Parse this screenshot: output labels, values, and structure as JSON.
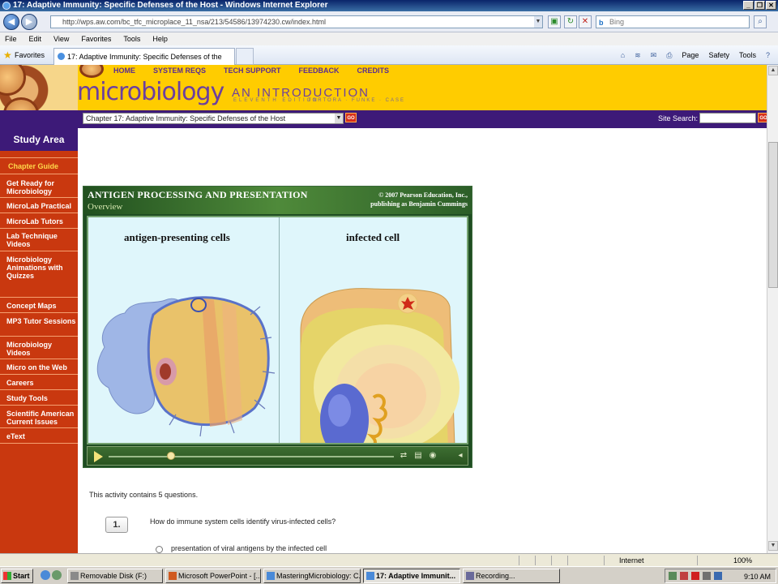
{
  "window": {
    "title": "17: Adaptive Immunity: Specific Defenses of the Host - Windows Internet Explorer"
  },
  "addressbar": {
    "url": "http://wps.aw.com/bc_tfc_microplace_11_nsa/213/54586/13974230.cw/index.html",
    "search_placeholder": "Bing"
  },
  "menubar": [
    "File",
    "Edit",
    "View",
    "Favorites",
    "Tools",
    "Help"
  ],
  "favorites": {
    "label": "Favorites",
    "tab_title": "17: Adaptive Immunity: Specific Defenses of the Host"
  },
  "command_bar": {
    "page": "Page",
    "safety": "Safety",
    "tools": "Tools"
  },
  "site": {
    "nav": [
      "HOME",
      "SYSTEM REQS",
      "TECH SUPPORT",
      "FEEDBACK",
      "CREDITS"
    ],
    "logo_main": "microbiology",
    "logo_sub": "AN INTRODUCTION",
    "logo_edition": "ELEVENTH EDITION",
    "logo_authors": "TORTORA · FUNKE · CASE",
    "chapter_select": "Chapter 17: Adaptive Immunity: Specific Defenses of the Host",
    "go_label": "GO",
    "site_search_label": "Site Search:"
  },
  "sidebar": {
    "title": "Study Area",
    "chapter_guide": "Chapter Guide",
    "items": [
      "Get Ready for Microbiology",
      "MicroLab Practical",
      "MicroLab Tutors",
      "Lab Technique Videos",
      "Microbiology Animations with Quizzes",
      "Concept Maps",
      "MP3 Tutor Sessions",
      "Microbiology Videos",
      "Micro on the Web",
      "Careers",
      "Study Tools",
      "Scientific American Current Issues",
      "eText"
    ]
  },
  "animation": {
    "title": "ANTIGEN PROCESSING AND PRESENTATION",
    "subtitle": "Overview",
    "copyright_1": "© 2007 Pearson Education, Inc.,",
    "copyright_2": "publishing as Benjamin Cummings",
    "left_label": "antigen-presenting cells",
    "right_label": "infected cell",
    "progress": 0.22
  },
  "quiz": {
    "intro": "This activity contains 5 questions.",
    "number": "1.",
    "question": "How do immune system cells identify virus-infected cells?",
    "option_1": "presentation of viral antigens by the infected cell"
  },
  "statusbar": {
    "zone": "Internet",
    "zoom": "100%"
  },
  "taskbar": {
    "start": "Start",
    "buttons": [
      "Removable Disk (F:)",
      "Microsoft PowerPoint - [...",
      "MasteringMicrobiology: C...",
      "17: Adaptive Immunit...",
      "Recording..."
    ],
    "clock": "9:10 AM"
  }
}
